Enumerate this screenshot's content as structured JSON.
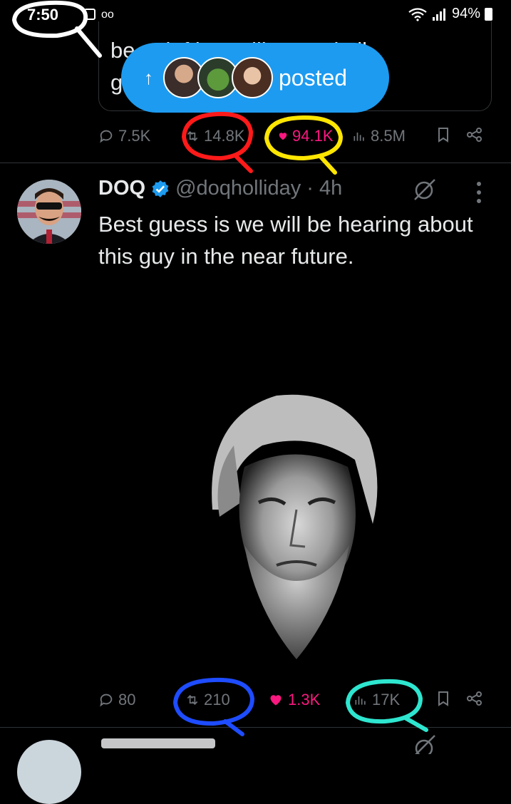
{
  "status_bar": {
    "time": "7:50",
    "battery": "94%"
  },
  "quote": {
    "line1": "be   ...   leftists   still   control all",
    "line2": "g                                     systems"
  },
  "posted_pill": {
    "label": "posted",
    "color": "#1d9bf0"
  },
  "top_actions": {
    "replies": "7.5K",
    "reposts": "14.8K",
    "likes": "94.1K",
    "views": "8.5M"
  },
  "tweet": {
    "author_name": "DOQ",
    "handle": "@doqholliday",
    "time": "· 4h",
    "text": "Best guess is we will be hearing about this guy in the near future.",
    "actions": {
      "replies": "80",
      "reposts": "210",
      "likes": "1.3K",
      "views": "17K"
    }
  },
  "colors": {
    "background": "#000000",
    "text": "#e7e9ea",
    "muted": "#71767b",
    "like_pink": "#f91880",
    "verified_blue": "#1d9bf0",
    "annotation_red": "#ff1a1a",
    "annotation_yellow": "#ffe600",
    "annotation_blue": "#1e4cff",
    "annotation_cyan": "#2ee6d0"
  }
}
